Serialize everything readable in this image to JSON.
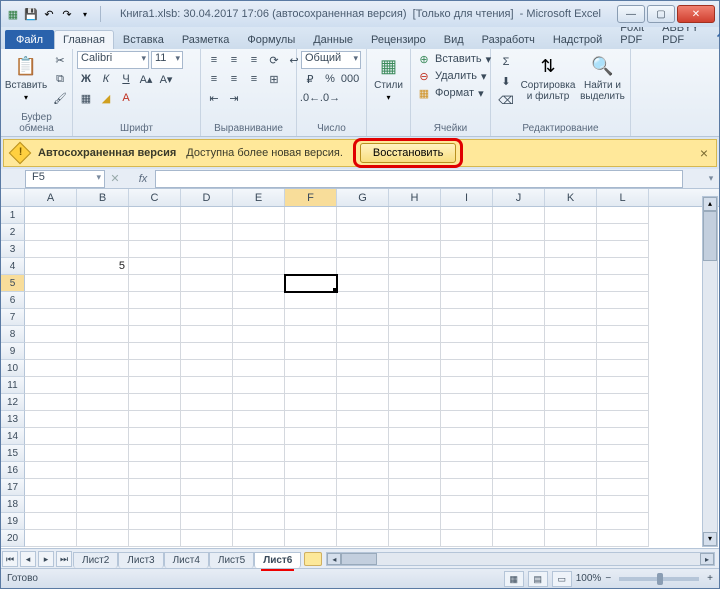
{
  "title": {
    "doc": "Книга1.xlsb: 30.04.2017 17:06 (автосохраненная версия)",
    "readonly": "[Только для чтения]",
    "app": "Microsoft Excel"
  },
  "tabs": {
    "file": "Файл",
    "home": "Главная",
    "insert": "Вставка",
    "layout": "Разметка",
    "formulas": "Формулы",
    "data": "Данные",
    "review": "Рецензиро",
    "view": "Вид",
    "dev": "Разработч",
    "addins": "Надстрой",
    "foxit": "Foxit PDF",
    "abbyy": "ABBYY PDF"
  },
  "groups": {
    "clipboard": {
      "label": "Буфер обмена",
      "paste": "Вставить"
    },
    "font": {
      "label": "Шрифт",
      "name": "Calibri",
      "size": "11"
    },
    "align": {
      "label": "Выравнивание"
    },
    "number": {
      "label": "Число",
      "format": "Общий"
    },
    "styles": {
      "label": "Стили",
      "btn": "Стили"
    },
    "cells": {
      "label": "Ячейки",
      "insert": "Вставить",
      "delete": "Удалить",
      "format": "Формат"
    },
    "editing": {
      "label": "Редактирование",
      "sort": "Сортировка и фильтр",
      "find": "Найти и выделить"
    }
  },
  "msgbar": {
    "title": "Автосохраненная версия",
    "text": "Доступна более новая версия.",
    "button": "Восстановить"
  },
  "namebox": "F5",
  "fx_label": "fx",
  "columns": [
    "A",
    "B",
    "C",
    "D",
    "E",
    "F",
    "G",
    "H",
    "I",
    "J",
    "K",
    "L"
  ],
  "rows": [
    "1",
    "2",
    "3",
    "4",
    "5",
    "6",
    "7",
    "8",
    "9",
    "10",
    "11",
    "12",
    "13",
    "14",
    "15",
    "16",
    "17",
    "18",
    "19",
    "20"
  ],
  "active_cell": {
    "col": "F",
    "row": "5"
  },
  "cell_data": {
    "B4": "5"
  },
  "sheets": [
    "Лист2",
    "Лист3",
    "Лист4",
    "Лист5",
    "Лист6"
  ],
  "active_sheet": "Лист6",
  "status": {
    "ready": "Готово",
    "zoom": "100%"
  }
}
